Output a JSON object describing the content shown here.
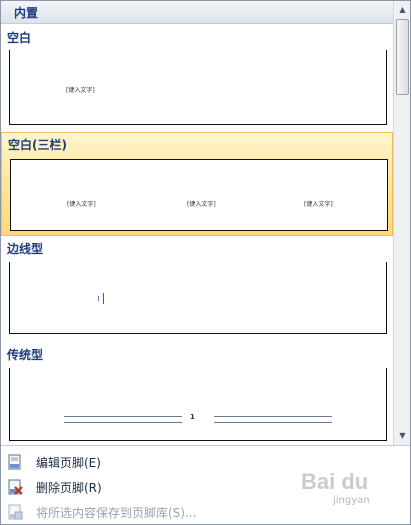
{
  "header": {
    "title": "内置"
  },
  "gallery": {
    "items": [
      {
        "title": "空白",
        "placeholders": [
          "[键入文字]"
        ]
      },
      {
        "title": "空白(三栏)",
        "placeholders": [
          "[键入文字]",
          "[键入文字]",
          "[键入文字]"
        ]
      },
      {
        "title": "边线型",
        "placeholders": []
      },
      {
        "title": "传统型",
        "page_number": "1"
      }
    ]
  },
  "scrollbar": {
    "up_glyph": "▲",
    "down_glyph": "▼"
  },
  "menu": {
    "items": [
      {
        "label": "编辑页脚(E)",
        "icon": "edit-footer-icon",
        "enabled": true
      },
      {
        "label": "删除页脚(R)",
        "icon": "delete-footer-icon",
        "enabled": true
      },
      {
        "label": "将所选内容保存到页脚库(S)...",
        "icon": "save-to-gallery-icon",
        "enabled": false
      }
    ]
  },
  "watermark": {
    "brand": "Bai du",
    "sub": "jingyan"
  }
}
